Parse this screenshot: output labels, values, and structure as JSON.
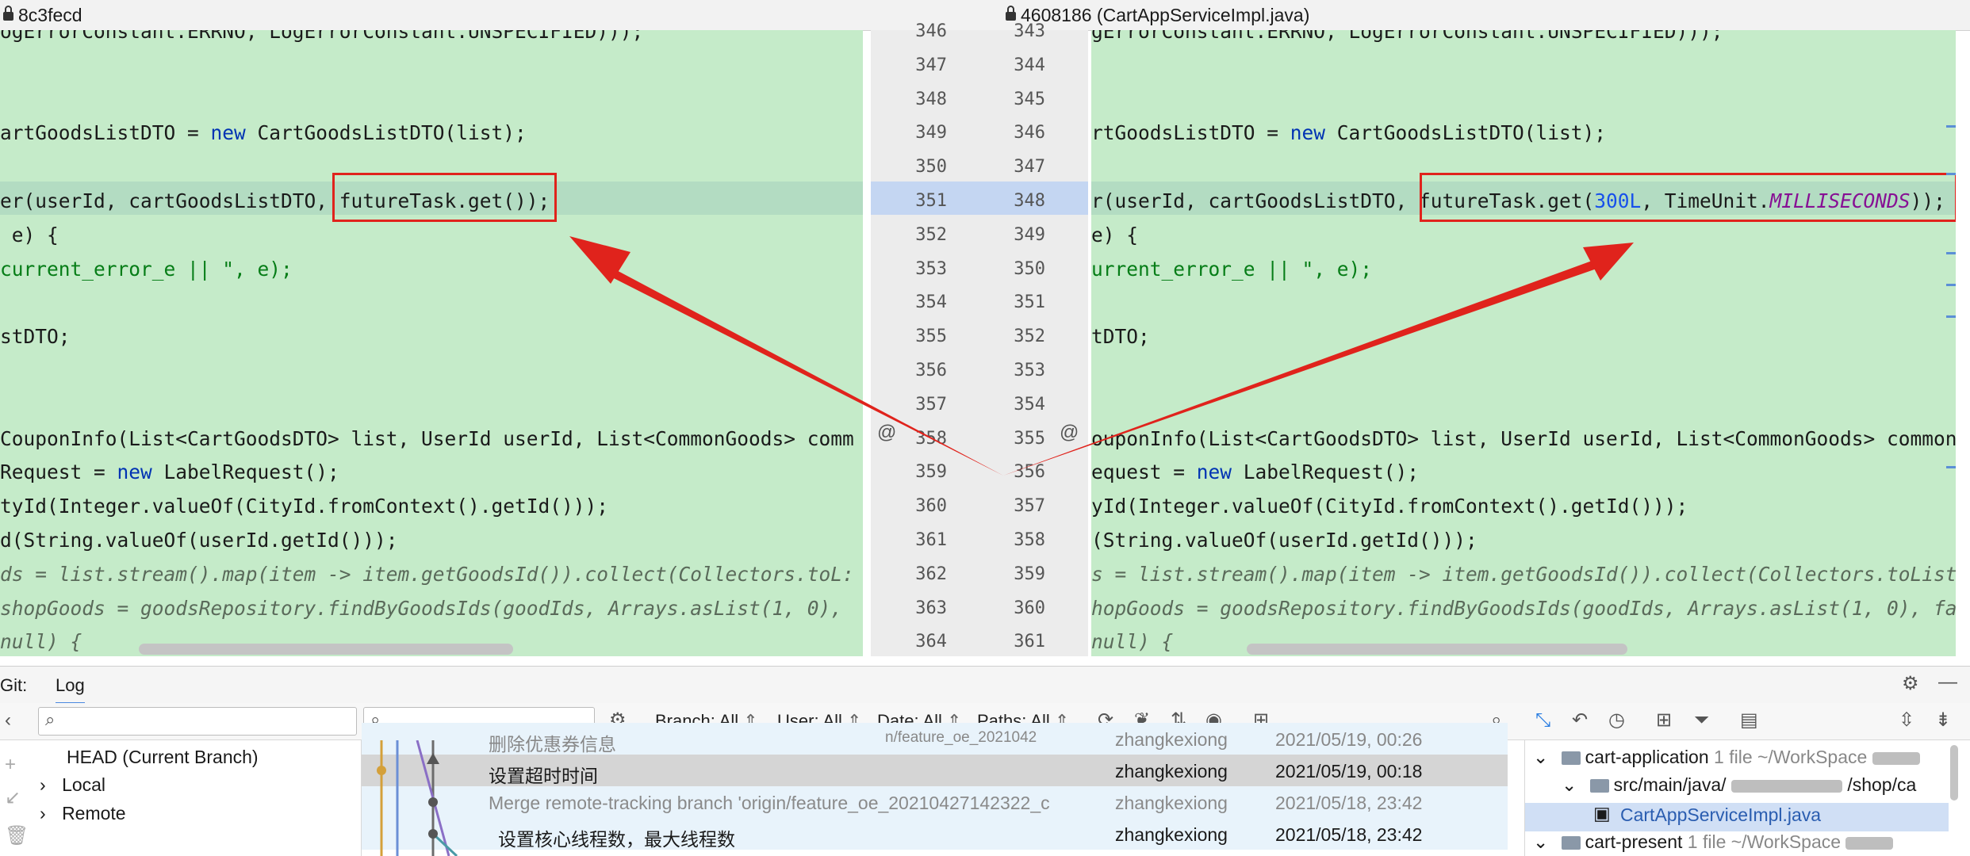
{
  "titles": {
    "left": "8c3fecd",
    "right": "4608186 (CartAppServiceImpl.java)"
  },
  "left_code": [
    "ogErrorConstant.ERRNO, LogErrorConstant.UNSPECIFIED)));",
    "",
    "",
    "artGoodsListDTO = new CartGoodsListDTO(list);",
    "",
    "er(userId, cartGoodsListDTO, futureTask.get());",
    " e) {",
    "current_error_e || \", e);",
    "",
    "stDTO;",
    "",
    "",
    "CouponInfo(List<CartGoodsDTO> list, UserId userId, List<CommonGoods> comm",
    "Request = new LabelRequest();",
    "tyId(Integer.valueOf(CityId.fromContext().getId()));",
    "d(String.valueOf(userId.getId()));",
    "ds = list.stream().map(item -> item.getGoodsId()).collect(Collectors.toL:",
    "shopGoods = goodsRepository.findByGoodsIds(goodIds, Arrays.asList(1, 0),",
    "null) {"
  ],
  "right_code": [
    "gErrorConstant.ERRNO, LogErrorConstant.UNSPECIFIED)));",
    "",
    "",
    "rtGoodsListDTO = new CartGoodsListDTO(list);",
    "",
    "r(userId, cartGoodsListDTO, futureTask.get(300L, TimeUnit.MILLISECONDS));",
    "e) {",
    "urrent_error_e || \", e);",
    "",
    "tDTO;",
    "",
    "",
    "ouponInfo(List<CartGoodsDTO> list, UserId userId, List<CommonGoods> common",
    "equest = new LabelRequest();",
    "yId(Integer.valueOf(CityId.fromContext().getId()));",
    "(String.valueOf(userId.getId()));",
    "s = list.stream().map(item -> item.getGoodsId()).collect(Collectors.toList",
    "hopGoods = goodsRepository.findByGoodsIds(goodIds, Arrays.asList(1, 0), fa",
    "null) {"
  ],
  "gutter": {
    "left": [
      "346",
      "347",
      "348",
      "349",
      "350",
      "351",
      "352",
      "353",
      "354",
      "355",
      "356",
      "357",
      "358",
      "359",
      "360",
      "361",
      "362",
      "363",
      "364"
    ],
    "right": [
      "343",
      "344",
      "345",
      "346",
      "347",
      "348",
      "349",
      "350",
      "351",
      "352",
      "353",
      "354",
      "355",
      "356",
      "357",
      "358",
      "359",
      "360",
      "361"
    ]
  },
  "git": {
    "label": "Git:",
    "tab_log": "Log"
  },
  "filters": {
    "branch": "Branch: All",
    "user": "User: All",
    "date": "Date: All",
    "paths": "Paths: All"
  },
  "refs": {
    "head": "HEAD (Current Branch)",
    "local": "Local",
    "remote": "Remote"
  },
  "commits": [
    {
      "message": "删除优惠券信息",
      "author": "zhangkexiong",
      "date": "2021/05/19, 00:26"
    },
    {
      "message": "设置超时时间",
      "author": "zhangkexiong",
      "date": "2021/05/19, 00:18"
    },
    {
      "message": "Merge remote-tracking branch 'origin/feature_oe_20210427142322_c",
      "author": "zhangkexiong",
      "date": "2021/05/18, 23:42"
    },
    {
      "message": "设置核心线程数，最大线程数",
      "author": "zhangkexiong",
      "date": "2021/05/18, 23:42"
    }
  ],
  "commit_tag": "n/feature_oe_2021042",
  "changed_files": {
    "module1": "cart-application",
    "module1_info": "1 file ~/WorkSpace",
    "path": "src/main/java/",
    "path_tail": "/shop/ca",
    "file": "CartAppServiceImpl.java",
    "module2": "cart-present",
    "module2_info": "1 file ~/WorkSpace"
  },
  "colors": {
    "added_bg": "#c5ebc9",
    "highlight_gutter": "#c4d6f2",
    "annotation_red": "#e0231c"
  }
}
